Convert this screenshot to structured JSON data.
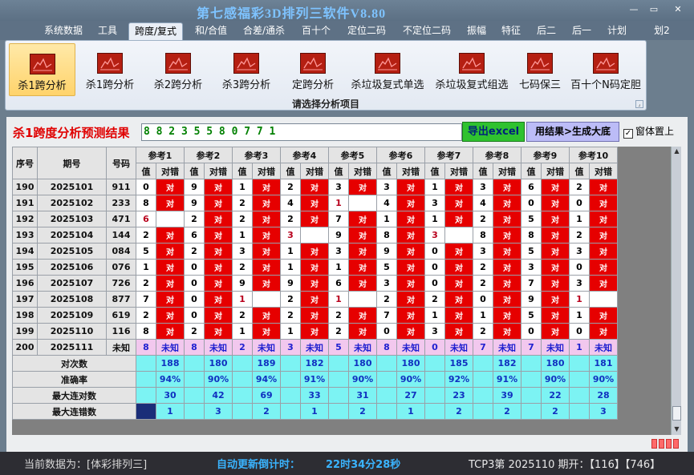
{
  "app": {
    "title": "第七感福彩3D排列三软件V8.80",
    "min": "—",
    "max": "▭",
    "close": "✕"
  },
  "menu": [
    "系统数据",
    "工具",
    "跨度/复式",
    "和/合值",
    "合差/通杀",
    "百十个",
    "定位二码",
    "不定位二码",
    "振幅",
    "特征",
    "后二",
    "后一",
    "计划",
    "划2"
  ],
  "ribbon": {
    "buttons": [
      "杀1跨分析",
      "杀1跨分析",
      "杀2跨分析",
      "杀3跨分析",
      "定跨分析",
      "杀垃圾复式单选",
      "杀垃圾复式组选",
      "七码保三",
      "百十个N码定胆"
    ],
    "caption": "请选择分析项目"
  },
  "result": {
    "title": "杀1跨度分析预测结果",
    "value": "8 8 2 3 5 5 8 0 7 7 1",
    "export": "导出excel",
    "generate": "用结果>生成大底",
    "topmost": "窗体置上"
  },
  "grid": {
    "headers": {
      "seq": "序号",
      "period": "期号",
      "number": "号码",
      "refs": [
        "参考1",
        "参考2",
        "参考3",
        "参考4",
        "参考5",
        "参考6",
        "参考7",
        "参考8",
        "参考9",
        "参考10"
      ],
      "val": "值",
      "err": "对错"
    },
    "rows": [
      {
        "seq": "190",
        "period": "2025101",
        "number": "911",
        "vals": [
          "0",
          "9",
          "1",
          "2",
          "3",
          "3",
          "1",
          "3",
          "6",
          "2"
        ],
        "ok": [
          1,
          1,
          1,
          1,
          1,
          1,
          1,
          1,
          1,
          1
        ]
      },
      {
        "seq": "191",
        "period": "2025102",
        "number": "233",
        "vals": [
          "8",
          "9",
          "2",
          "4",
          "1",
          "4",
          "3",
          "4",
          "0",
          "0"
        ],
        "ok": [
          1,
          1,
          1,
          1,
          0,
          1,
          1,
          1,
          1,
          1
        ]
      },
      {
        "seq": "192",
        "period": "2025103",
        "number": "471",
        "vals": [
          "6",
          "2",
          "2",
          "2",
          "7",
          "1",
          "1",
          "2",
          "5",
          "1"
        ],
        "ok": [
          0,
          1,
          1,
          1,
          1,
          1,
          1,
          1,
          1,
          1
        ]
      },
      {
        "seq": "193",
        "period": "2025104",
        "number": "144",
        "vals": [
          "2",
          "6",
          "1",
          "3",
          "9",
          "8",
          "3",
          "8",
          "8",
          "2"
        ],
        "ok": [
          1,
          1,
          1,
          0,
          1,
          1,
          0,
          1,
          1,
          1
        ]
      },
      {
        "seq": "194",
        "period": "2025105",
        "number": "084",
        "vals": [
          "5",
          "2",
          "3",
          "1",
          "3",
          "9",
          "0",
          "3",
          "5",
          "3"
        ],
        "ok": [
          1,
          1,
          1,
          1,
          1,
          1,
          1,
          1,
          1,
          1
        ]
      },
      {
        "seq": "195",
        "period": "2025106",
        "number": "076",
        "vals": [
          "1",
          "0",
          "2",
          "1",
          "1",
          "5",
          "0",
          "2",
          "3",
          "0"
        ],
        "ok": [
          1,
          1,
          1,
          1,
          1,
          1,
          1,
          1,
          1,
          1
        ]
      },
      {
        "seq": "196",
        "period": "2025107",
        "number": "726",
        "vals": [
          "2",
          "0",
          "9",
          "9",
          "6",
          "3",
          "0",
          "2",
          "7",
          "3"
        ],
        "ok": [
          1,
          1,
          1,
          1,
          1,
          1,
          1,
          1,
          1,
          1
        ]
      },
      {
        "seq": "197",
        "period": "2025108",
        "number": "877",
        "vals": [
          "7",
          "0",
          "1",
          "2",
          "1",
          "2",
          "2",
          "0",
          "9",
          "1"
        ],
        "ok": [
          1,
          1,
          0,
          1,
          0,
          1,
          1,
          1,
          1,
          0
        ]
      },
      {
        "seq": "198",
        "period": "2025109",
        "number": "619",
        "vals": [
          "2",
          "0",
          "2",
          "2",
          "2",
          "7",
          "1",
          "1",
          "5",
          "1"
        ],
        "ok": [
          1,
          1,
          1,
          1,
          1,
          1,
          1,
          1,
          1,
          1
        ]
      },
      {
        "seq": "199",
        "period": "2025110",
        "number": "116",
        "vals": [
          "8",
          "2",
          "1",
          "1",
          "2",
          "0",
          "3",
          "2",
          "0",
          "0"
        ],
        "ok": [
          1,
          1,
          1,
          1,
          1,
          1,
          1,
          1,
          1,
          1
        ]
      }
    ],
    "pending": {
      "seq": "200",
      "period": "2025111",
      "number": "未知",
      "vals": [
        "8",
        "8",
        "2",
        "3",
        "5",
        "8",
        "0",
        "7",
        "7",
        "1"
      ],
      "status": "未知"
    },
    "ok_text": "对",
    "stats": [
      {
        "label": "对次数",
        "values": [
          "188",
          "180",
          "189",
          "182",
          "180",
          "180",
          "185",
          "182",
          "180",
          "181"
        ]
      },
      {
        "label": "准确率",
        "values": [
          "94%",
          "90%",
          "94%",
          "91%",
          "90%",
          "90%",
          "92%",
          "91%",
          "90%",
          "90%"
        ]
      },
      {
        "label": "最大连对数",
        "values": [
          "30",
          "42",
          "69",
          "33",
          "31",
          "27",
          "23",
          "39",
          "22",
          "28"
        ]
      },
      {
        "label": "最大连错数",
        "values": [
          "1",
          "3",
          "2",
          "1",
          "2",
          "1",
          "2",
          "2",
          "2",
          "3"
        ]
      }
    ]
  },
  "status": {
    "current": "当前数据为：[体彩排列三]",
    "countdown_label": "自动更新倒计时：",
    "countdown": "22时34分28秒",
    "info": "TCP3第 2025110 期开：【116】【746】"
  },
  "colors": {
    "red": "#e60000",
    "cyan": "#7cf3f3",
    "pink": "#f2c8ee",
    "title_blue": "#7ec3ff"
  }
}
